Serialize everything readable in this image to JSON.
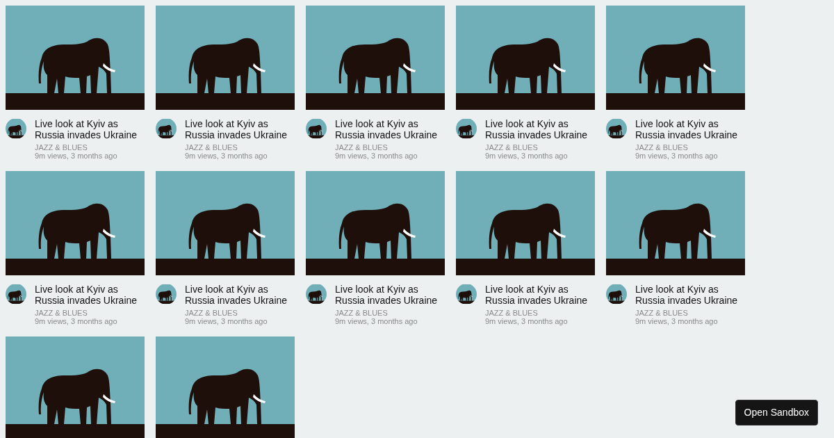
{
  "videos": [
    {
      "kind": "full",
      "title": "Live look at Kyiv as Russia invades Ukraine",
      "channel": "JAZZ & BLUES",
      "meta": "9m views, 3 months ago"
    },
    {
      "kind": "full",
      "title": "Live look at Kyiv as Russia invades Ukraine",
      "channel": "JAZZ & BLUES",
      "meta": "9m views, 3 months ago"
    },
    {
      "kind": "full",
      "title": "Live look at Kyiv as Russia invades Ukraine",
      "channel": "JAZZ & BLUES",
      "meta": "9m views, 3 months ago"
    },
    {
      "kind": "full",
      "title": "Live look at Kyiv as Russia invades Ukraine",
      "channel": "JAZZ & BLUES",
      "meta": "9m views, 3 months ago"
    },
    {
      "kind": "full",
      "title": "Live look at Kyiv as Russia invades Ukraine",
      "channel": "JAZZ & BLUES",
      "meta": "9m views, 3 months ago"
    },
    {
      "kind": "full",
      "title": "Live look at Kyiv as Russia invades Ukraine",
      "channel": "JAZZ & BLUES",
      "meta": "9m views, 3 months ago"
    },
    {
      "kind": "full",
      "title": "Live look at Kyiv as Russia invades Ukraine",
      "channel": "JAZZ & BLUES",
      "meta": "9m views, 3 months ago"
    },
    {
      "kind": "full",
      "title": "Live look at Kyiv as Russia invades Ukraine",
      "channel": "JAZZ & BLUES",
      "meta": "9m views, 3 months ago"
    },
    {
      "kind": "full",
      "title": "Live look at Kyiv as Russia invades Ukraine",
      "channel": "JAZZ & BLUES",
      "meta": "9m views, 3 months ago"
    },
    {
      "kind": "full",
      "title": "Live look at Kyiv as Russia invades Ukraine",
      "channel": "JAZZ & BLUES",
      "meta": "9m views, 3 months ago"
    },
    {
      "kind": "thumbnail_only"
    },
    {
      "kind": "thumbnail_only"
    }
  ],
  "button": {
    "label": "Open Sandbox"
  }
}
